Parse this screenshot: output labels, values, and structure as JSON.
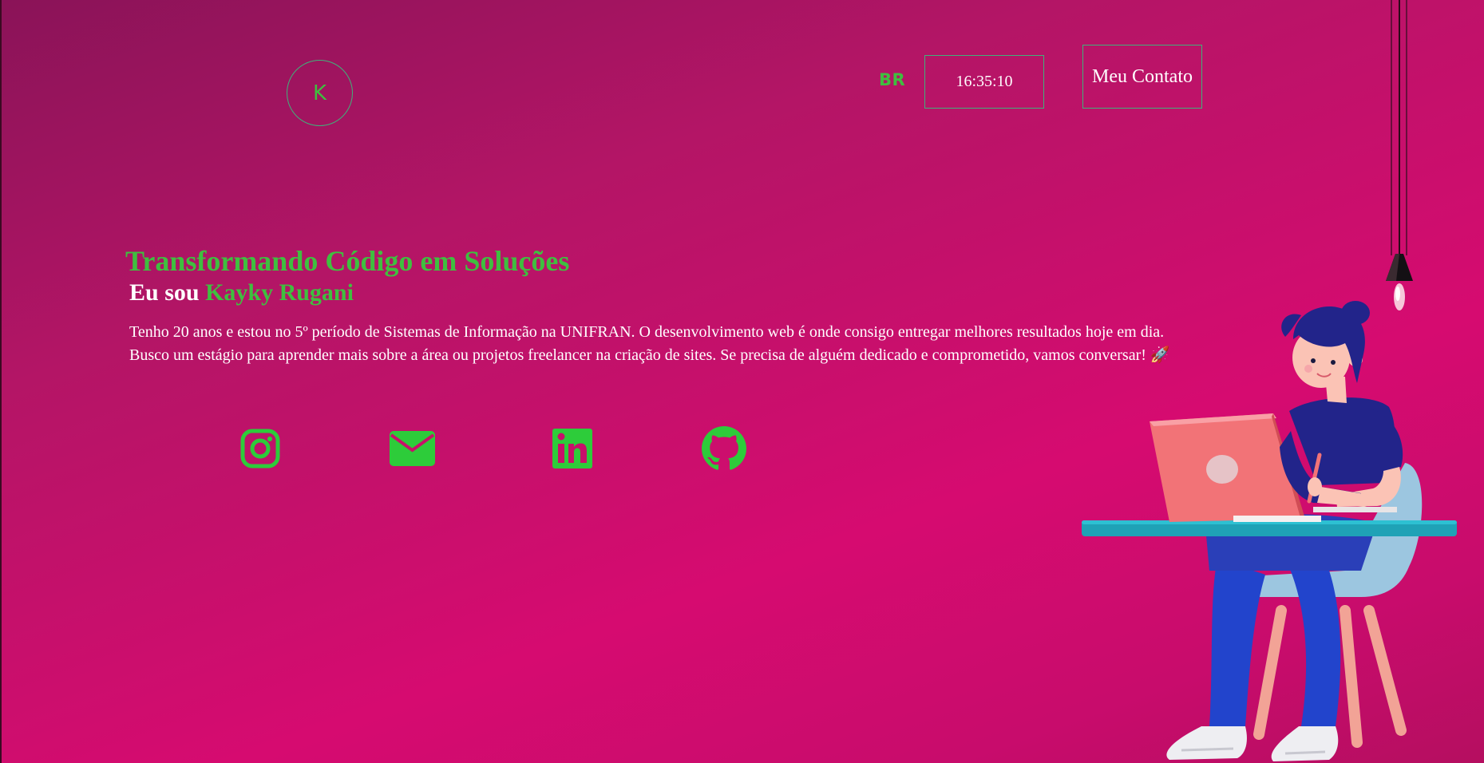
{
  "header": {
    "logo_letter": "K",
    "language": "BR",
    "clock": "16:35:10",
    "contact_button": "Meu Contato"
  },
  "hero": {
    "headline": "Transformando Código em Soluções",
    "intro_prefix": "Eu sou",
    "intro_name": "Kayky Rugani",
    "bio_line1": "Tenho 20 anos e estou no 5º período de Sistemas de Informação na UNIFRAN. O desenvolvimento web é onde consigo entregar melhores resultados hoje em dia.",
    "bio_line2": "Busco um estágio para aprender mais sobre a área ou projetos freelancer na criação de sites. Se precisa de alguém dedicado e comprometido, vamos conversar! 🚀"
  },
  "social": [
    {
      "icon": "instagram-icon"
    },
    {
      "icon": "mail-icon"
    },
    {
      "icon": "linkedin-icon"
    },
    {
      "icon": "github-icon"
    }
  ],
  "colors": {
    "accent": "#3fbf3f",
    "background_top": "#8a1358",
    "background_bottom": "#d60b70"
  }
}
